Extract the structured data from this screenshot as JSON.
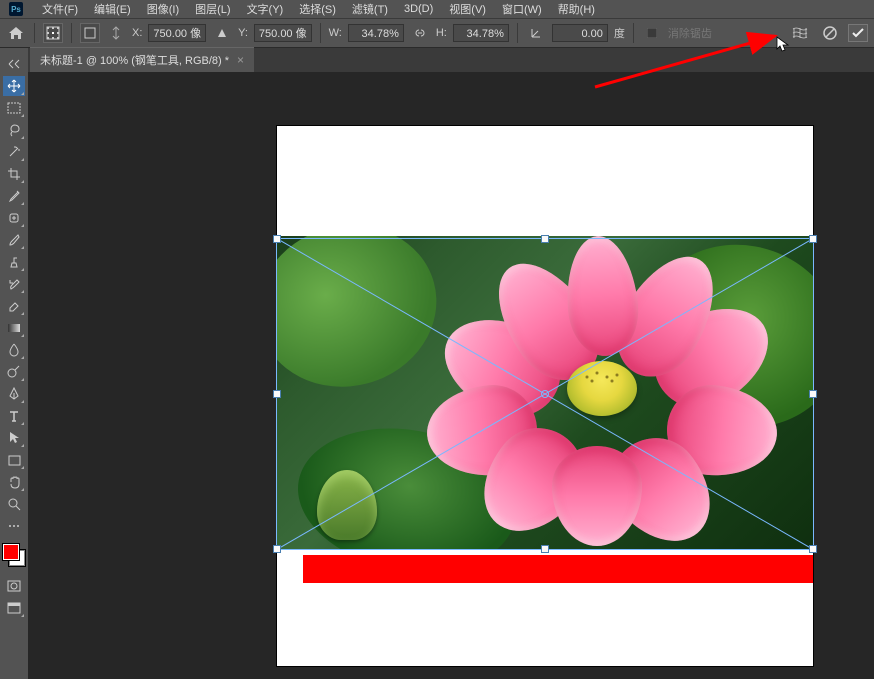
{
  "menu": {
    "file": "文件(F)",
    "edit": "编辑(E)",
    "image": "图像(I)",
    "layer": "图层(L)",
    "type": "文字(Y)",
    "select": "选择(S)",
    "filter": "滤镜(T)",
    "threeD": "3D(D)",
    "view": "视图(V)",
    "window": "窗口(W)",
    "help": "帮助(H)"
  },
  "options": {
    "x_label": "X:",
    "x_value": "750.00 像",
    "y_label": "Y:",
    "y_value": "750.00 像",
    "w_label": "W:",
    "w_value": "34.78%",
    "h_label": "H:",
    "h_value": "34.78%",
    "angle_value": "0.00",
    "angle_unit": "度",
    "antialias": "消除锯齿"
  },
  "tab": {
    "title": "未标题-1 @ 100% (钢笔工具, RGB/8) *"
  },
  "colors": {
    "foreground": "#ff0000",
    "background": "#ffffff",
    "redbar": "#ff0000"
  }
}
